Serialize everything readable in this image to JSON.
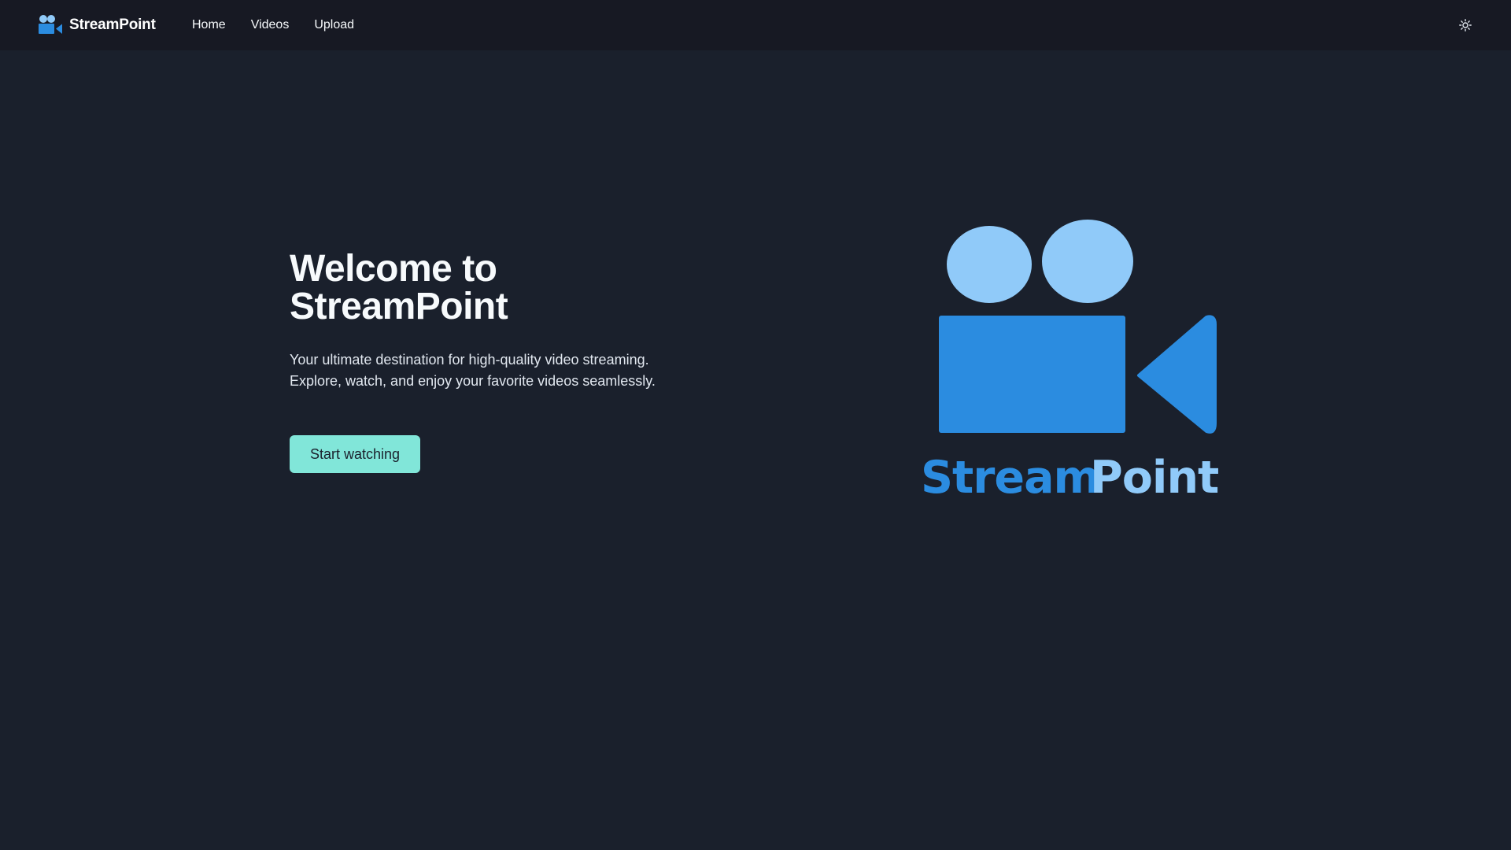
{
  "app": {
    "brand_name": "StreamPoint"
  },
  "nav": {
    "links": [
      {
        "label": "Home"
      },
      {
        "label": "Videos"
      },
      {
        "label": "Upload"
      }
    ],
    "theme_icon": "sun-icon"
  },
  "hero": {
    "title_line1": "Welcome to",
    "title_line2": "StreamPoint",
    "description_line1": "Your ultimate destination for high-quality video streaming.",
    "description_line2": "Explore, watch, and enjoy your favorite videos seamlessly.",
    "cta_label": "Start watching",
    "logo_word_1": "Stream",
    "logo_word_2": "Point"
  },
  "colors": {
    "background": "#1a202c",
    "navbar": "#171923",
    "cta": "#81e6d9",
    "logo_dark_blue": "#2b8ce0",
    "logo_light_blue": "#90caf9"
  }
}
